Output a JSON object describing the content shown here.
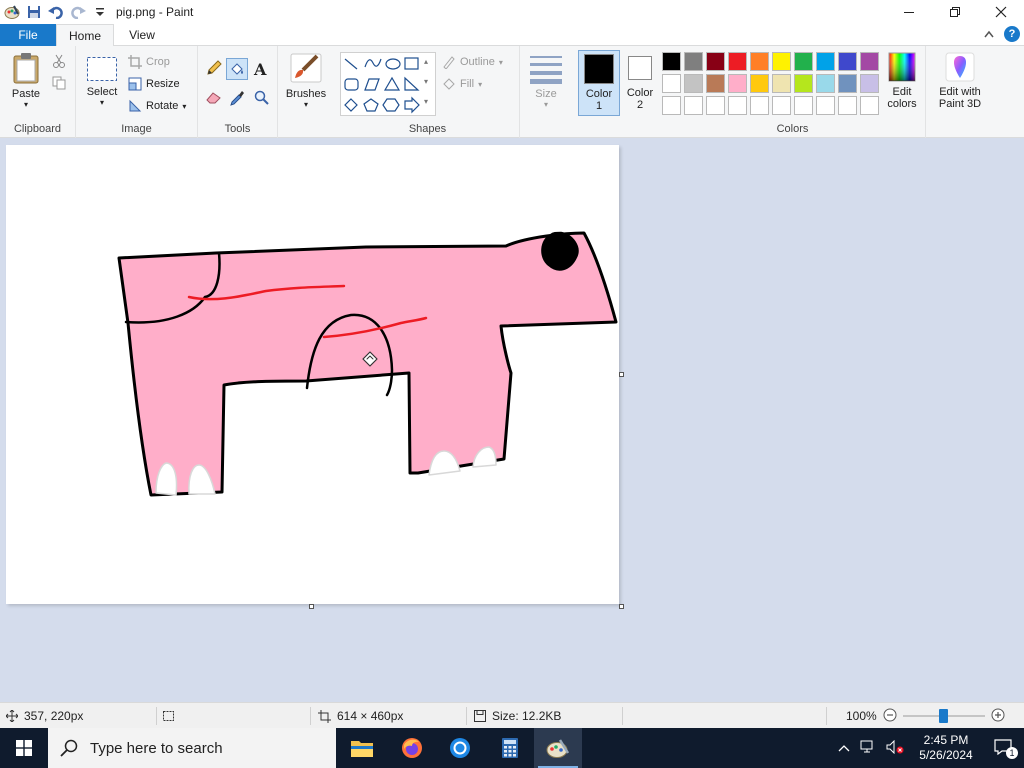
{
  "window": {
    "title": "pig.png - Paint"
  },
  "tabs": {
    "file": "File",
    "home": "Home",
    "view": "View"
  },
  "ribbon": {
    "clipboard": {
      "label": "Clipboard",
      "paste": "Paste"
    },
    "image": {
      "label": "Image",
      "select": "Select",
      "crop": "Crop",
      "resize": "Resize",
      "rotate": "Rotate"
    },
    "tools": {
      "label": "Tools"
    },
    "brushes": {
      "label": "Brushes"
    },
    "shapes": {
      "label": "Shapes",
      "outline": "Outline",
      "fill": "Fill"
    },
    "size": {
      "label": "Size"
    },
    "color1": {
      "line1": "Color",
      "line2": "1"
    },
    "color2": {
      "line1": "Color",
      "line2": "2"
    },
    "colors": {
      "label": "Colors"
    },
    "edit_colors": {
      "line1": "Edit",
      "line2": "colors"
    },
    "paint3d": {
      "line1": "Edit with",
      "line2": "Paint 3D"
    }
  },
  "palette": {
    "row1": [
      "#000000",
      "#7f7f7f",
      "#880015",
      "#ed1c24",
      "#ff7f27",
      "#fff200",
      "#22b14c",
      "#00a2e8",
      "#3f48cc",
      "#a349a4"
    ],
    "row2": [
      "#ffffff",
      "#c3c3c3",
      "#b97a57",
      "#ffaec9",
      "#ffc90e",
      "#efe4b0",
      "#b5e61d",
      "#99d9ea",
      "#7092be",
      "#c8bfe7"
    ],
    "row3": [
      "#ffffff",
      "#ffffff",
      "#ffffff",
      "#ffffff",
      "#ffffff",
      "#ffffff",
      "#ffffff",
      "#ffffff",
      "#ffffff",
      "#ffffff"
    ],
    "color1": "#000000",
    "color2": "#ffffff"
  },
  "drawing": {
    "body_color": "#ffaec9",
    "outline_color": "#000000",
    "stripe_color": "#ed1c24"
  },
  "status": {
    "cursor_pos": "357, 220px",
    "image_size": "614 × 460px",
    "file_size": "Size: 12.2KB",
    "zoom": "100%",
    "zoom_level": 1.0
  },
  "taskbar": {
    "search_placeholder": "Type here to search",
    "time": "2:45 PM",
    "date": "5/26/2024",
    "notifications": "1"
  }
}
